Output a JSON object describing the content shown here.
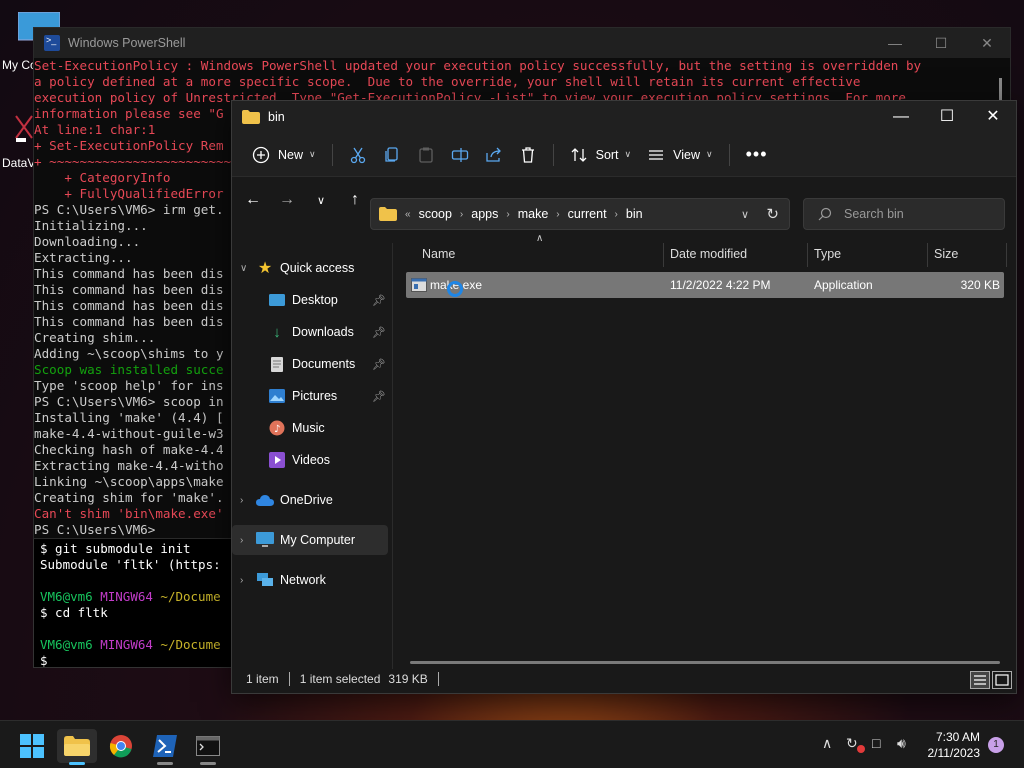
{
  "desktop": {
    "icon1_label": "My Co",
    "icon2_label": "DataV"
  },
  "powershell": {
    "title": "Windows PowerShell",
    "lines": [
      {
        "t": "Set-ExecutionPolicy : Windows PowerShell updated your execution policy successfully, but the setting is overridden by",
        "c": "red"
      },
      {
        "t": "a policy defined at a more specific scope.  Due to the override, your shell will retain its current effective",
        "c": "red"
      },
      {
        "t": "execution policy of Unrestricted. Type \"Get-ExecutionPolicy -List\" to view your execution policy settings. For more",
        "c": "red"
      },
      {
        "t": "information please see \"G",
        "c": "red"
      },
      {
        "t": "At line:1 char:1",
        "c": "red"
      },
      {
        "t": "+ Set-ExecutionPolicy Rem",
        "c": "red"
      },
      {
        "t": "+ ~~~~~~~~~~~~~~~~~~~~~~~~",
        "c": "red"
      },
      {
        "t": "    + CategoryInfo",
        "c": "red"
      },
      {
        "t": "    + FullyQualifiedError",
        "c": "red"
      },
      {
        "t": "PS C:\\Users\\VM6> irm get.",
        "c": "plain"
      },
      {
        "t": "Initializing...",
        "c": "plain"
      },
      {
        "t": "Downloading...",
        "c": "plain"
      },
      {
        "t": "Extracting...",
        "c": "plain"
      },
      {
        "t": "This command has been dis",
        "c": "plain"
      },
      {
        "t": "This command has been dis",
        "c": "plain"
      },
      {
        "t": "This command has been dis",
        "c": "plain"
      },
      {
        "t": "This command has been dis",
        "c": "plain"
      },
      {
        "t": "Creating shim...",
        "c": "plain"
      },
      {
        "t": "Adding ~\\scoop\\shims to y",
        "c": "plain"
      },
      {
        "t": "Scoop was installed succe",
        "c": "green"
      },
      {
        "t": "Type 'scoop help' for ins",
        "c": "plain"
      },
      {
        "t": "PS C:\\Users\\VM6> scoop in",
        "c": "plain"
      },
      {
        "t": "Installing 'make' (4.4) [",
        "c": "plain"
      },
      {
        "t": "make-4.4-without-guile-w3",
        "c": "plain"
      },
      {
        "t": "Checking hash of make-4.4",
        "c": "plain"
      },
      {
        "t": "Extracting make-4.4-witho",
        "c": "plain"
      },
      {
        "t": "Linking ~\\scoop\\apps\\make",
        "c": "plain"
      },
      {
        "t": "Creating shim for 'make'.",
        "c": "plain"
      },
      {
        "t": "Can't shim 'bin\\make.exe'",
        "c": "red"
      },
      {
        "t": "PS C:\\Users\\VM6>",
        "c": "plain"
      }
    ]
  },
  "bash": {
    "lines": [
      {
        "t": "$ git submodule init",
        "c": "plain"
      },
      {
        "t": "Submodule 'fltk' (https:",
        "c": "plain"
      },
      {
        "t": "",
        "c": "plain"
      },
      {
        "user": "VM6@vm6",
        "sys": "MINGW64",
        "path": "~/Docume"
      },
      {
        "t": "$ cd fltk",
        "c": "plain"
      },
      {
        "t": "",
        "c": "plain"
      },
      {
        "user": "VM6@vm6",
        "sys": "MINGW64",
        "path": "~/Docume"
      },
      {
        "t": "$",
        "c": "plain"
      }
    ]
  },
  "explorer": {
    "title": "bin",
    "commands": {
      "new": "New",
      "sort": "Sort",
      "view": "View"
    },
    "breadcrumb": [
      "scoop",
      "apps",
      "make",
      "current",
      "bin"
    ],
    "search_placeholder": "Search bin",
    "nav": {
      "quick_access": "Quick access",
      "desktop": "Desktop",
      "downloads": "Downloads",
      "documents": "Documents",
      "pictures": "Pictures",
      "music": "Music",
      "videos": "Videos",
      "onedrive": "OneDrive",
      "my_computer": "My Computer",
      "network": "Network"
    },
    "columns": {
      "name": "Name",
      "date": "Date modified",
      "type": "Type",
      "size": "Size"
    },
    "files": [
      {
        "name": "make.exe",
        "date": "11/2/2022 4:22 PM",
        "type": "Application",
        "size": "320 KB"
      }
    ],
    "status": {
      "count": "1 item",
      "selected": "1 item selected",
      "sel_size": "319 KB"
    }
  },
  "taskbar": {
    "time": "7:30 AM",
    "date": "2/11/2023",
    "notification_count": "1"
  },
  "colors": {
    "accent": "#4cc2ff",
    "selection": "#777777",
    "ps_error": "#e74856"
  }
}
